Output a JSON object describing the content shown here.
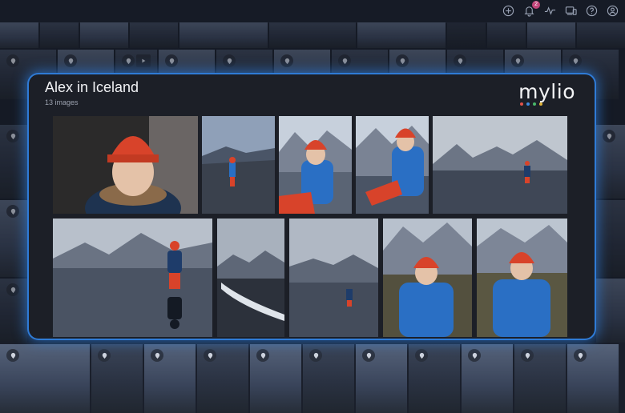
{
  "topbar": {
    "icons": [
      "add-icon",
      "bell-icon",
      "activity-icon",
      "devices-icon",
      "help-icon",
      "user-icon"
    ],
    "notification_count": "2"
  },
  "album": {
    "title": "Alex in Iceland",
    "subtitle": "13 images",
    "logo_text": "mylio",
    "logo_dot_colors": [
      "#e0524a",
      "#3c8be0",
      "#4ab86a",
      "#e0b43a"
    ]
  },
  "colors": {
    "accent_glow": "#2f7bd6",
    "card_bg": "#1c1f27",
    "jacket_blue": "#2a6fc4",
    "hat_red": "#d8432a"
  }
}
